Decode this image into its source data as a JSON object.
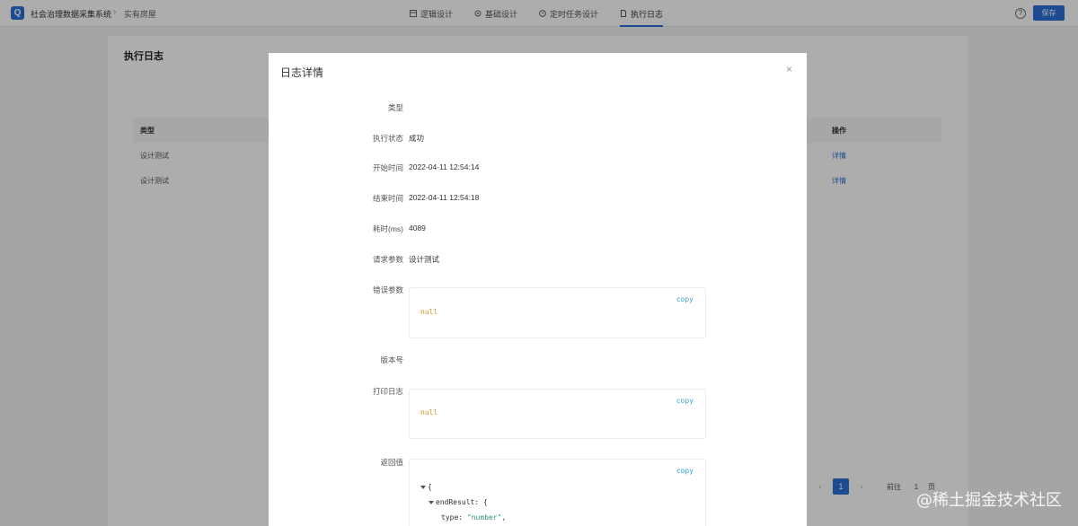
{
  "topbar": {
    "app_title": "社会治理数据采集系统",
    "breadcrumb_sep": "›",
    "breadcrumb": "实有房屋",
    "nav": [
      {
        "label": "逻辑设计",
        "icon": "layout-icon",
        "active": false
      },
      {
        "label": "基础设计",
        "icon": "gear-icon",
        "active": false
      },
      {
        "label": "定时任务设计",
        "icon": "clock-icon",
        "active": false
      },
      {
        "label": "执行日志",
        "icon": "document-icon",
        "active": true
      }
    ],
    "help": "?",
    "save_label": "保存",
    "accent_color": "#2a6fd6"
  },
  "panel": {
    "title": "执行日志",
    "columns": {
      "type": "类型",
      "op": "操作"
    },
    "rows": [
      {
        "type": "设计测试",
        "op": "详情"
      },
      {
        "type": "设计测试",
        "op": "详情"
      }
    ],
    "pager": {
      "prev": "‹",
      "current": "1",
      "next": "›",
      "goto": "前往",
      "page_input": "1",
      "unit": "页"
    }
  },
  "modal": {
    "title": "日志详情",
    "close": "×",
    "fields": {
      "type": {
        "label": "类型",
        "value": ""
      },
      "status": {
        "label": "执行状态",
        "value": "成功"
      },
      "start": {
        "label": "开始时间",
        "value": "2022-04-11 12:54:14"
      },
      "end": {
        "label": "结束时间",
        "value": "2022-04-11 12:54:18"
      },
      "duration": {
        "label": "耗时(ms)",
        "value": "4089"
      },
      "request": {
        "label": "请求参数",
        "value": "设计测试"
      },
      "error": {
        "label": "错误参数",
        "copy": "copy",
        "value": "null"
      },
      "version": {
        "label": "版本号",
        "value": ""
      },
      "print_log": {
        "label": "打印日志",
        "copy": "copy",
        "value": "null"
      },
      "return": {
        "label": "返回值",
        "copy": "copy",
        "tree": {
          "open_brace": "{",
          "key1": "endResult",
          "colon": ":",
          "key1_brace": "{",
          "key2": "type",
          "key2_value": "\"number\"",
          "comma": ","
        }
      }
    }
  },
  "watermark": "@稀土掘金技术社区"
}
